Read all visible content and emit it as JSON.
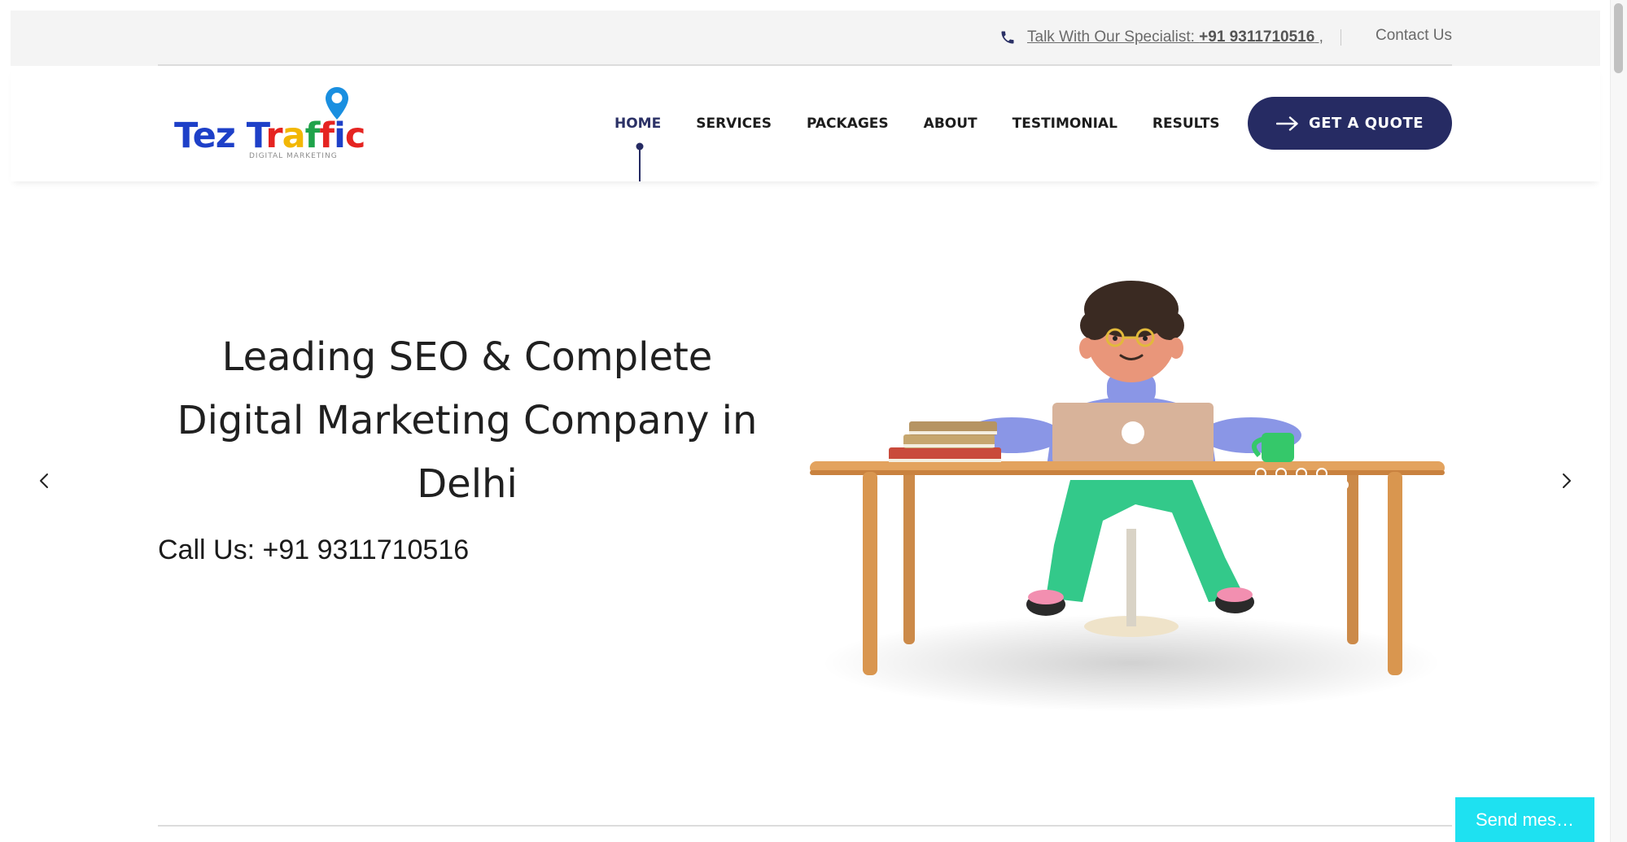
{
  "topbar": {
    "specialist_prefix": "Talk With Our Specialist: ",
    "specialist_phone": "+91 9311710516",
    "specialist_suffix": " ,",
    "contact_label": "Contact Us"
  },
  "logo": {
    "word_part1": "Tez",
    "word_part2": "Traffic",
    "tagline": "DIGITAL MARKETING"
  },
  "nav": {
    "items": [
      {
        "label": "HOME",
        "active": true
      },
      {
        "label": "SERVICES"
      },
      {
        "label": "PACKAGES"
      },
      {
        "label": "ABOUT"
      },
      {
        "label": "TESTIMONIAL"
      },
      {
        "label": "RESULTS"
      }
    ],
    "quote_label": "GET A QUOTE"
  },
  "hero": {
    "heading_lines": [
      "Leading SEO & Complete",
      "Digital Marketing Company in",
      "Delhi"
    ],
    "call_us": "Call Us: +91 9311710516"
  },
  "chat": {
    "label": "Send mes…"
  },
  "colors": {
    "brand_navy": "#262b63",
    "topbar_bg": "#f4f4f4",
    "chat_cyan": "#1ee1f1",
    "logo_blue": "#1e40c8",
    "logo_red": "#e52421",
    "logo_yellow": "#f2b705",
    "logo_green": "#1fa34a",
    "pin_blue": "#1a8fe0"
  },
  "icons": {
    "phone": "phone-icon",
    "quote_arrow": "arrow-right-icon",
    "prev": "chevron-left-icon",
    "next": "chevron-right-icon",
    "pin": "map-pin-icon"
  }
}
